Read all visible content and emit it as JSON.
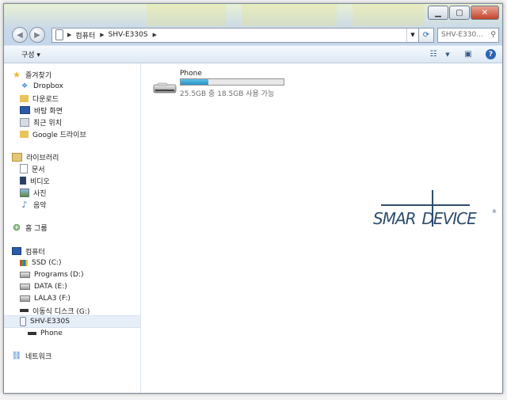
{
  "address": {
    "crumbs": [
      "컴퓨터",
      "SHV-E330S"
    ]
  },
  "search": {
    "placeholder": "SHV-E330..."
  },
  "toolbar": {
    "organize_label": "구성 ▾"
  },
  "nav": {
    "favorites": {
      "label": "즐겨찾기",
      "items": [
        "Dropbox",
        "다운로드",
        "바탕 화면",
        "최근 위치",
        "Google 드라이브"
      ]
    },
    "libraries": {
      "label": "라이브러리",
      "items": [
        "문서",
        "비디오",
        "사진",
        "음악"
      ]
    },
    "homegroup": {
      "label": "홈 그룹"
    },
    "computer": {
      "label": "컴퓨터",
      "items": [
        "SSD (C:)",
        "Programs (D:)",
        "DATA (E:)",
        "LALA3 (F:)",
        "이동식 디스크 (G:)",
        "SHV-E330S",
        "Phone"
      ]
    },
    "network": {
      "label": "네트워크"
    }
  },
  "content": {
    "storage_name": "Phone",
    "space_text": "25.5GB 중 18.5GB 사용 가능",
    "used_fraction": 0.27
  },
  "watermark": {
    "text": "SMARTDEVICE"
  },
  "colors": {
    "selection": "#e6eef8",
    "bar_fill": "#2891c7",
    "accent": "#2d64b3"
  }
}
